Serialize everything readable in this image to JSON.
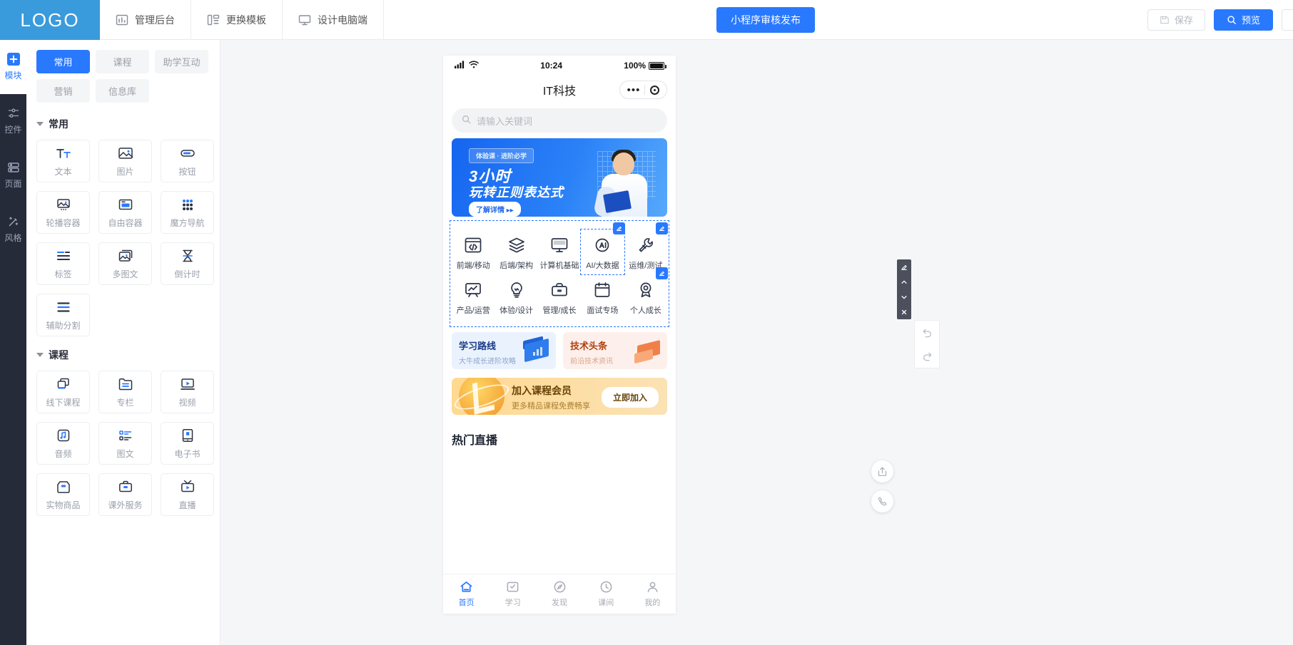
{
  "header": {
    "logo": "LOGO",
    "nav": [
      {
        "label": "管理后台",
        "icon": "dashboard-icon"
      },
      {
        "label": "更换模板",
        "icon": "template-icon"
      },
      {
        "label": "设计电脑端",
        "icon": "monitor-icon"
      }
    ],
    "publish_label": "小程序审核发布",
    "save_label": "保存",
    "preview_label": "预览"
  },
  "rail": [
    {
      "label": "模块",
      "icon": "plus-icon",
      "active": true
    },
    {
      "label": "控件",
      "icon": "controls-icon",
      "active": false
    },
    {
      "label": "页面",
      "icon": "pages-icon",
      "active": false
    },
    {
      "label": "风格",
      "icon": "magic-wand-icon",
      "active": false
    }
  ],
  "panel": {
    "tabs": [
      {
        "label": "常用",
        "active": true
      },
      {
        "label": "课程",
        "active": false
      },
      {
        "label": "助学互动",
        "active": false
      },
      {
        "label": "营销",
        "active": false
      },
      {
        "label": "信息库",
        "active": false
      }
    ],
    "groups": [
      {
        "title": "常用",
        "items": [
          {
            "label": "文本",
            "icon": "text-icon"
          },
          {
            "label": "图片",
            "icon": "image-icon"
          },
          {
            "label": "按钮",
            "icon": "button-icon"
          },
          {
            "label": "轮播容器",
            "icon": "carousel-icon"
          },
          {
            "label": "自由容器",
            "icon": "free-container-icon"
          },
          {
            "label": "魔方导航",
            "icon": "magic-nav-icon"
          },
          {
            "label": "标签",
            "icon": "tag-icon"
          },
          {
            "label": "多图文",
            "icon": "multi-image-text-icon"
          },
          {
            "label": "倒计时",
            "icon": "countdown-icon"
          },
          {
            "label": "辅助分割",
            "icon": "divider-icon"
          }
        ]
      },
      {
        "title": "课程",
        "items": [
          {
            "label": "线下课程",
            "icon": "offline-course-icon"
          },
          {
            "label": "专栏",
            "icon": "column-icon"
          },
          {
            "label": "视频",
            "icon": "video-icon"
          },
          {
            "label": "音频",
            "icon": "audio-icon"
          },
          {
            "label": "图文",
            "icon": "image-text-icon"
          },
          {
            "label": "电子书",
            "icon": "ebook-icon"
          },
          {
            "label": "实物商品",
            "icon": "goods-icon"
          },
          {
            "label": "课外服务",
            "icon": "service-icon"
          },
          {
            "label": "直播",
            "icon": "live-icon"
          }
        ]
      }
    ]
  },
  "preview": {
    "status": {
      "time": "10:24",
      "battery": "100%"
    },
    "title": "IT科技",
    "search_placeholder": "请输入关键词",
    "banner": {
      "badge": "体验课 · 进阶必学",
      "line1": "3小时",
      "line2": "玩转正则表达式",
      "cta": "了解详情 ▸▸"
    },
    "nav_grid": [
      {
        "label": "前端/移动",
        "icon": "code-window-icon",
        "selected": false
      },
      {
        "label": "后端/架构",
        "icon": "layers-icon",
        "selected": false
      },
      {
        "label": "计算机基础",
        "icon": "desktop-icon",
        "selected": false
      },
      {
        "label": "AI/大数据",
        "icon": "ai-chip-icon",
        "selected": true
      },
      {
        "label": "运维/测试",
        "icon": "wrench-icon",
        "selected": false
      },
      {
        "label": "产品/运营",
        "icon": "chart-board-icon",
        "selected": false
      },
      {
        "label": "体验/设计",
        "icon": "lightbulb-icon",
        "selected": false
      },
      {
        "label": "管理/成长",
        "icon": "briefcase-icon",
        "selected": false
      },
      {
        "label": "面试专场",
        "icon": "calendar-icon",
        "selected": false
      },
      {
        "label": "个人成长",
        "icon": "medal-icon",
        "selected": false
      }
    ],
    "cards": [
      {
        "title": "学习路线",
        "subtitle": "大牛成长进阶攻略",
        "theme": "blue"
      },
      {
        "title": "技术头条",
        "subtitle": "前沿技术资讯",
        "theme": "pink"
      }
    ],
    "member": {
      "title": "加入课程会员",
      "subtitle": "更多精品课程免费畅享",
      "button": "立即加入"
    },
    "section_title": "热门直播",
    "tabbar": [
      {
        "label": "首页",
        "icon": "home-icon",
        "active": true
      },
      {
        "label": "学习",
        "icon": "study-icon",
        "active": false
      },
      {
        "label": "发现",
        "icon": "compass-icon",
        "active": false
      },
      {
        "label": "课间",
        "icon": "clock-icon",
        "active": false
      },
      {
        "label": "我的",
        "icon": "user-icon",
        "active": false
      }
    ]
  },
  "float_tools": {
    "edit": "edit-icon",
    "up": "chevron-up-icon",
    "down": "chevron-down-icon",
    "close": "close-icon",
    "undo": "undo-icon",
    "redo": "redo-icon",
    "share": "share-icon",
    "phone": "phone-icon"
  },
  "colors": {
    "accent": "#2979ff",
    "logo_bg": "#3a9bdc",
    "rail_bg": "#262b3a"
  }
}
